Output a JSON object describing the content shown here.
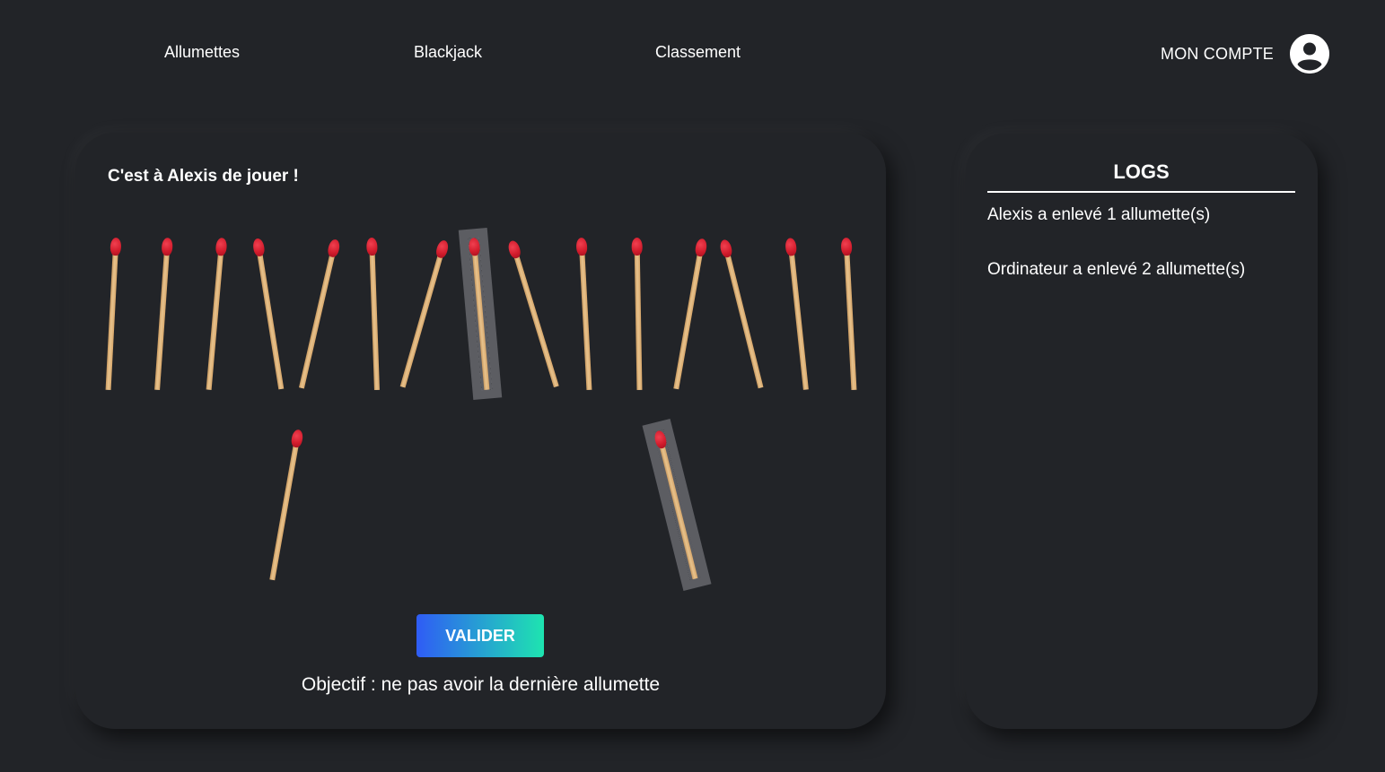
{
  "nav": {
    "items": [
      "Allumettes",
      "Blackjack",
      "Classement"
    ],
    "account_label": "MON COMPTE"
  },
  "game": {
    "turn_text": "C'est à Alexis de jouer !",
    "validate_label": "VALIDER",
    "objective": "Objectif : ne pas avoir la dernière allumette",
    "matches_remaining": 17,
    "matches_selected": 2,
    "match_head_color": "#d21c2c",
    "match_stick_color": "#e0b47a"
  },
  "logs": {
    "title": "LOGS",
    "entries": [
      "Alexis a enlevé 1 allumette(s)",
      "Ordinateur a enlevé 2 allumette(s)"
    ]
  },
  "colors": {
    "background": "#222428",
    "button_gradient_start": "#2f5cf5",
    "button_gradient_end": "#1ee4b0",
    "selection_overlay": "#8c8c91"
  }
}
